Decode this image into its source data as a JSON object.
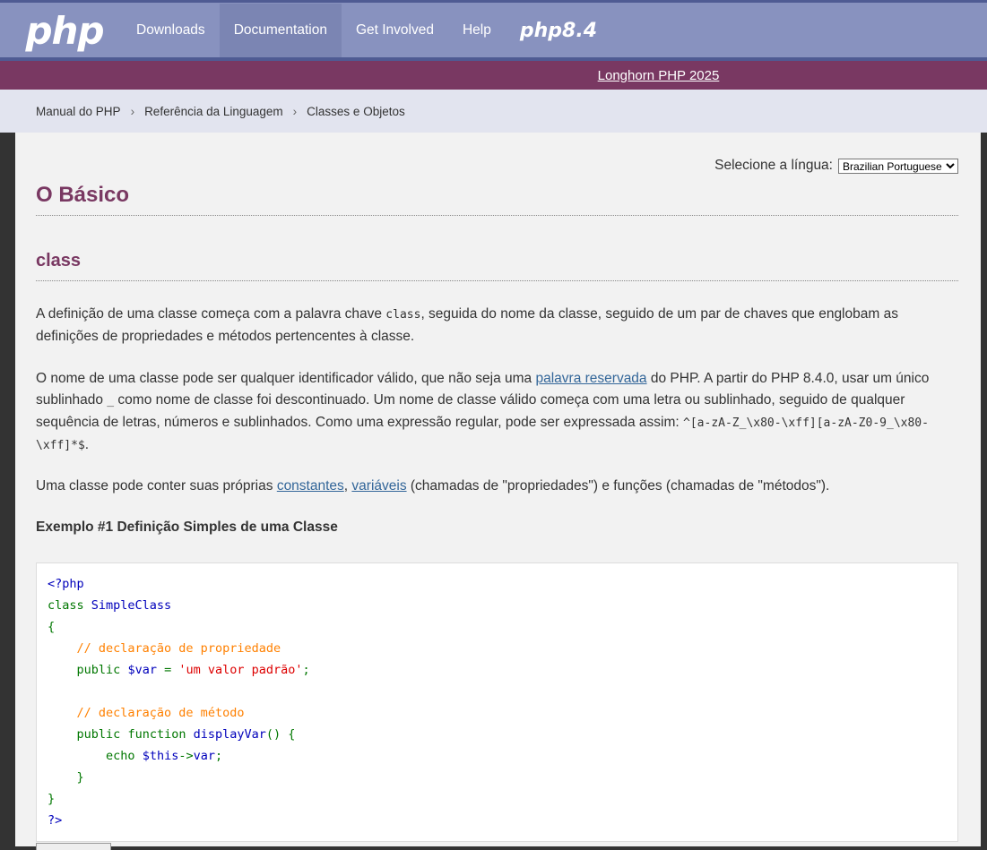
{
  "nav": {
    "logo": "php",
    "items": [
      "Downloads",
      "Documentation",
      "Get Involved",
      "Help"
    ],
    "version_logo": "php8.4"
  },
  "promo": {
    "link": "Longhorn PHP 2025"
  },
  "breadcrumbs": [
    "Manual do PHP",
    "Referência da Linguagem",
    "Classes e Objetos"
  ],
  "lang": {
    "label": "Selecione a língua:",
    "selected": "Brazilian Portuguese"
  },
  "content": {
    "title": "O Básico",
    "subtitle": "class",
    "p1_a": "A definição de uma classe começa com a palavra chave ",
    "p1_code": "class",
    "p1_b": ", seguida do nome da classe, seguido de um par de chaves que englobam as definições de propriedades e métodos pertencentes à classe.",
    "p2_a": "O nome de uma classe pode ser qualquer identificador válido, que não seja uma ",
    "p2_link": "palavra reservada",
    "p2_b": " do PHP. A partir do PHP 8.4.0, usar um único sublinhado ",
    "p2_code1": "_",
    "p2_c": " como nome de classe foi descontinuado. Um nome de classe válido começa com uma letra ou sublinhado, seguido de qualquer sequência de letras, números e sublinhados. Como uma expressão regular, pode ser expressada assim: ",
    "p2_code2": "^[a-zA-Z_\\x80-\\xff][a-zA-Z0-9_\\x80-\\xff]*$",
    "p2_d": ".",
    "p3_a": "Uma classe pode conter suas próprias ",
    "p3_link1": "constantes",
    "p3_comma": ", ",
    "p3_link2": "variáveis",
    "p3_b": " (chamadas de \"propriedades\") e funções (chamadas de \"métodos\").",
    "example_title": "Exemplo #1 Definição Simples de uma Classe"
  },
  "code": {
    "open": "<?php",
    "kw_class": "class",
    "class_name": "SimpleClass",
    "brace_open": "{",
    "comment1": "// declaração de propriedade",
    "kw_public1": "public",
    "var_name": "$var",
    "assign": " = ",
    "str_val": "'um valor padrão'",
    "semi1": ";",
    "comment2": "// declaração de método",
    "kw_public2": "public",
    "kw_function": "function",
    "method_name": "displayVar",
    "method_tail": "() {",
    "kw_echo": "echo",
    "this": "$this",
    "arrow": "->",
    "prop": "var",
    "semi2": ";",
    "inner_close": "}",
    "brace_close": "}",
    "close": "?>"
  }
}
